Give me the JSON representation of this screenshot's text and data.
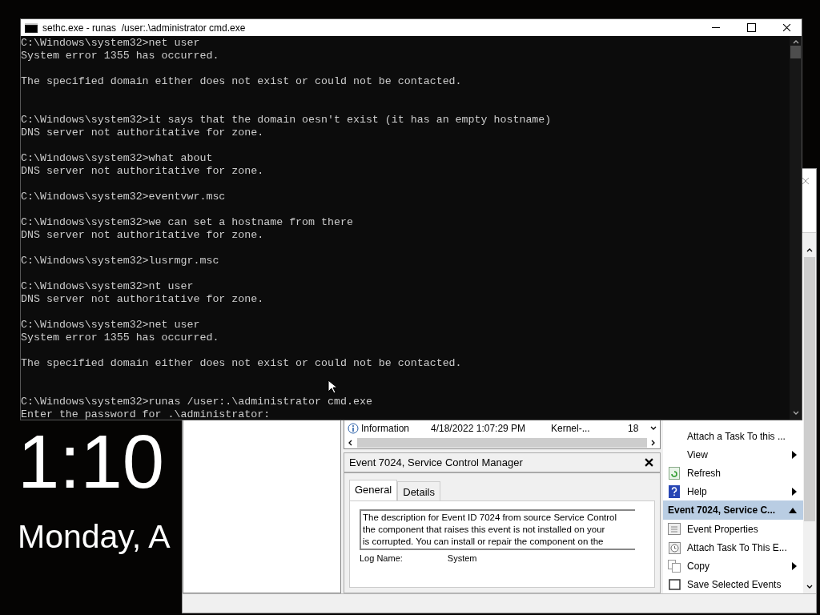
{
  "lock_screen": {
    "time": "1:10",
    "date": "Monday, A"
  },
  "event_viewer": {
    "events": [
      {
        "level": "Information",
        "date_time": "4/18/2022 1:07:29 PM",
        "source": "Kernel-...",
        "column_4": "18"
      }
    ],
    "detail": {
      "title": "Event 7024, Service Control Manager",
      "tabs": [
        {
          "label": "General",
          "selected": true
        },
        {
          "label": "Details",
          "selected": false
        }
      ],
      "description": [
        "The description for Event ID 7024 from source Service Control",
        "the component that raises this event is not installed on your",
        "is corrupted. You can install or repair the component on the"
      ],
      "field_label": "Log Name:",
      "field_value": "System"
    },
    "actions": [
      {
        "kind": "plain",
        "label": "Attach a Task To this ...",
        "submenu": false
      },
      {
        "kind": "plain",
        "label": "View",
        "submenu": true
      },
      {
        "kind": "refresh",
        "label": "Refresh",
        "submenu": false
      },
      {
        "kind": "help",
        "label": "Help",
        "submenu": true
      },
      {
        "kind": "header",
        "label": "Event 7024, Service C...",
        "expanded": true
      },
      {
        "kind": "properties",
        "label": "Event Properties",
        "submenu": false
      },
      {
        "kind": "task",
        "label": "Attach Task To This E...",
        "submenu": false
      },
      {
        "kind": "copy",
        "label": "Copy",
        "submenu": true
      },
      {
        "kind": "save",
        "label": "Save Selected Events",
        "submenu": false
      }
    ]
  },
  "cmd_window": {
    "title": "sethc.exe - runas  /user:.\\administrator cmd.exe",
    "lines": [
      {
        "kind": "text",
        "text": "C:\\Windows\\system32>net user"
      },
      {
        "kind": "text",
        "text": "System error 1355 has occurred."
      },
      {
        "kind": "blank"
      },
      {
        "kind": "text",
        "text": "The specified domain either does not exist or could not be contacted."
      },
      {
        "kind": "blank"
      },
      {
        "kind": "blank"
      },
      {
        "kind": "text",
        "text": "C:\\Windows\\system32>it says that the domain oesn't exist (it has an empty hostname)"
      },
      {
        "kind": "text",
        "text": "DNS server not authoritative for zone."
      },
      {
        "kind": "blank"
      },
      {
        "kind": "text",
        "text": "C:\\Windows\\system32>what about"
      },
      {
        "kind": "text",
        "text": "DNS server not authoritative for zone."
      },
      {
        "kind": "blank"
      },
      {
        "kind": "text",
        "text": "C:\\Windows\\system32>eventvwr.msc"
      },
      {
        "kind": "blank"
      },
      {
        "kind": "text",
        "text": "C:\\Windows\\system32>we can set a hostname from there"
      },
      {
        "kind": "text",
        "text": "DNS server not authoritative for zone."
      },
      {
        "kind": "blank"
      },
      {
        "kind": "text",
        "text": "C:\\Windows\\system32>lusrmgr.msc"
      },
      {
        "kind": "blank"
      },
      {
        "kind": "text",
        "text": "C:\\Windows\\system32>nt user"
      },
      {
        "kind": "text",
        "text": "DNS server not authoritative for zone."
      },
      {
        "kind": "blank"
      },
      {
        "kind": "text",
        "text": "C:\\Windows\\system32>net user"
      },
      {
        "kind": "text",
        "text": "System error 1355 has occurred."
      },
      {
        "kind": "blank"
      },
      {
        "kind": "text",
        "text": "The specified domain either does not exist or could not be contacted."
      },
      {
        "kind": "blank"
      },
      {
        "kind": "blank"
      },
      {
        "kind": "text",
        "text": "C:\\Windows\\system32>runas /user:.\\administrator cmd.exe"
      },
      {
        "kind": "text",
        "text": "Enter the password for .\\administrator:"
      }
    ]
  }
}
